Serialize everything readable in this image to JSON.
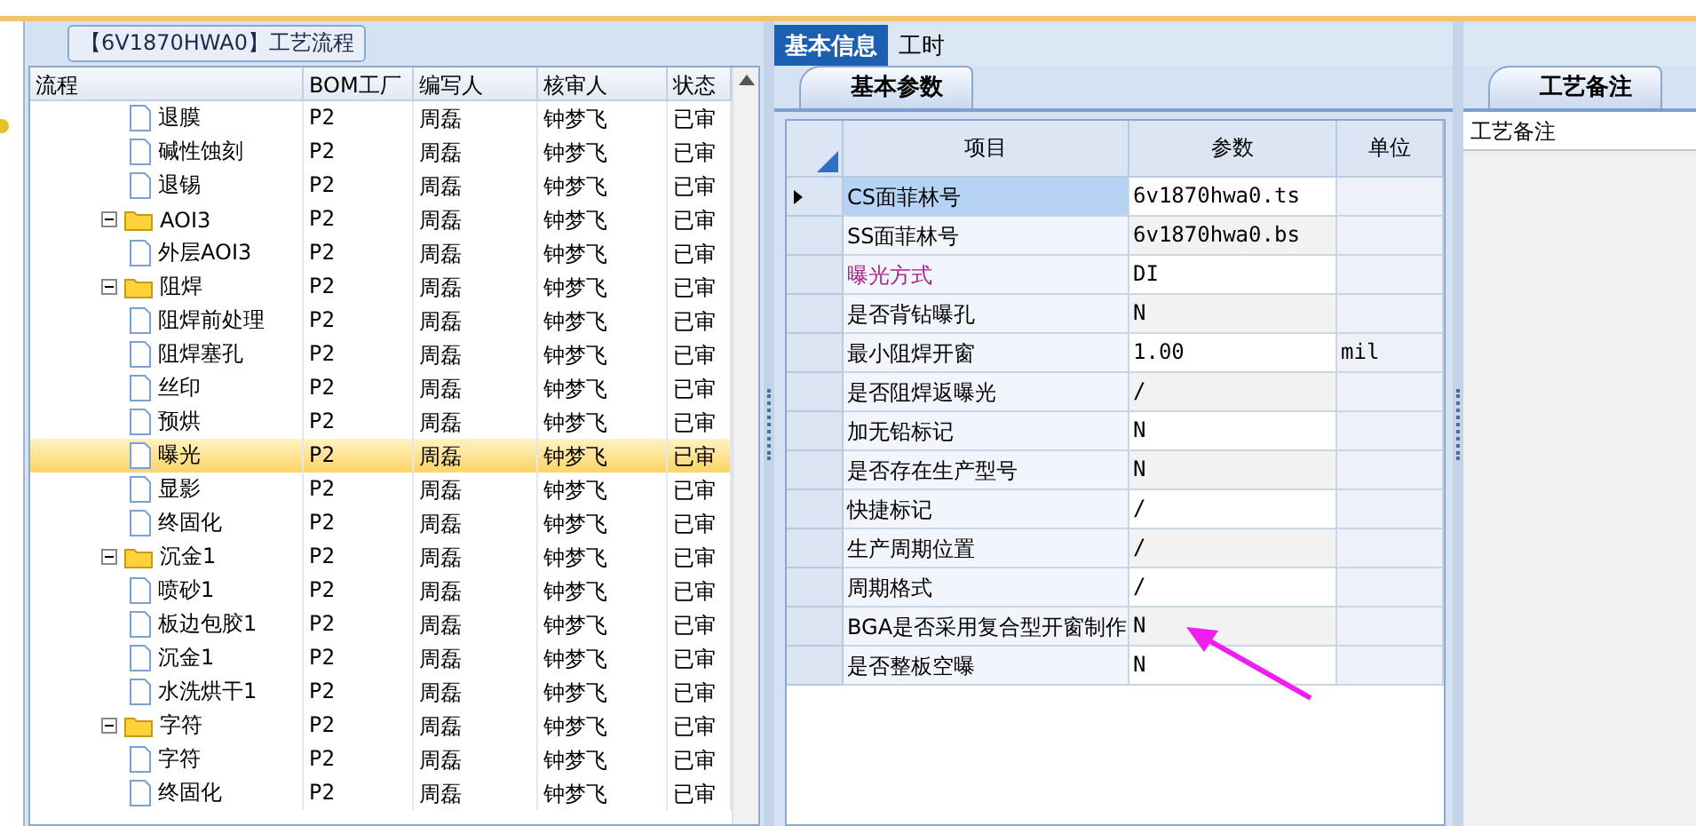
{
  "flow_panel": {
    "title": "【6V1870HWA0】工艺流程",
    "columns": [
      "流程",
      "BOM工厂",
      "编写人",
      "核审人",
      "状态"
    ],
    "rows": [
      {
        "kind": "file",
        "label": "退膜",
        "factory": "P2",
        "writer": "周磊",
        "reviewer": "钟梦飞",
        "status": "已审",
        "selected": false
      },
      {
        "kind": "file",
        "label": "碱性蚀刻",
        "factory": "P2",
        "writer": "周磊",
        "reviewer": "钟梦飞",
        "status": "已审",
        "selected": false
      },
      {
        "kind": "file",
        "label": "退锡",
        "factory": "P2",
        "writer": "周磊",
        "reviewer": "钟梦飞",
        "status": "已审",
        "selected": false
      },
      {
        "kind": "folder",
        "label": "AOI3",
        "factory": "P2",
        "writer": "周磊",
        "reviewer": "钟梦飞",
        "status": "已审",
        "selected": false,
        "expanded": true,
        "children": [
          {
            "kind": "file",
            "label": "外层AOI3",
            "factory": "P2",
            "writer": "周磊",
            "reviewer": "钟梦飞",
            "status": "已审",
            "selected": false
          }
        ]
      },
      {
        "kind": "folder",
        "label": "阻焊",
        "factory": "P2",
        "writer": "周磊",
        "reviewer": "钟梦飞",
        "status": "已审",
        "selected": false,
        "expanded": true,
        "children": [
          {
            "kind": "file",
            "label": "阻焊前处理",
            "factory": "P2",
            "writer": "周磊",
            "reviewer": "钟梦飞",
            "status": "已审",
            "selected": false
          },
          {
            "kind": "file",
            "label": "阻焊塞孔",
            "factory": "P2",
            "writer": "周磊",
            "reviewer": "钟梦飞",
            "status": "已审",
            "selected": false
          },
          {
            "kind": "file",
            "label": "丝印",
            "factory": "P2",
            "writer": "周磊",
            "reviewer": "钟梦飞",
            "status": "已审",
            "selected": false
          },
          {
            "kind": "file",
            "label": "预烘",
            "factory": "P2",
            "writer": "周磊",
            "reviewer": "钟梦飞",
            "status": "已审",
            "selected": false
          },
          {
            "kind": "file",
            "label": "曝光",
            "factory": "P2",
            "writer": "周磊",
            "reviewer": "钟梦飞",
            "status": "已审",
            "selected": true
          },
          {
            "kind": "file",
            "label": "显影",
            "factory": "P2",
            "writer": "周磊",
            "reviewer": "钟梦飞",
            "status": "已审",
            "selected": false
          },
          {
            "kind": "file",
            "label": "终固化",
            "factory": "P2",
            "writer": "周磊",
            "reviewer": "钟梦飞",
            "status": "已审",
            "selected": false
          }
        ]
      },
      {
        "kind": "folder",
        "label": "沉金1",
        "factory": "P2",
        "writer": "周磊",
        "reviewer": "钟梦飞",
        "status": "已审",
        "selected": false,
        "expanded": true,
        "children": [
          {
            "kind": "file",
            "label": "喷砂1",
            "factory": "P2",
            "writer": "周磊",
            "reviewer": "钟梦飞",
            "status": "已审",
            "selected": false
          },
          {
            "kind": "file",
            "label": "板边包胶1",
            "factory": "P2",
            "writer": "周磊",
            "reviewer": "钟梦飞",
            "status": "已审",
            "selected": false
          },
          {
            "kind": "file",
            "label": "沉金1",
            "factory": "P2",
            "writer": "周磊",
            "reviewer": "钟梦飞",
            "status": "已审",
            "selected": false
          },
          {
            "kind": "file",
            "label": "水洗烘干1",
            "factory": "P2",
            "writer": "周磊",
            "reviewer": "钟梦飞",
            "status": "已审",
            "selected": false
          }
        ]
      },
      {
        "kind": "folder",
        "label": "字符",
        "factory": "P2",
        "writer": "周磊",
        "reviewer": "钟梦飞",
        "status": "已审",
        "selected": false,
        "expanded": true,
        "children": [
          {
            "kind": "file",
            "label": "字符",
            "factory": "P2",
            "writer": "周磊",
            "reviewer": "钟梦飞",
            "status": "已审",
            "selected": false
          },
          {
            "kind": "file",
            "label": "终固化",
            "factory": "P2",
            "writer": "周磊",
            "reviewer": "钟梦飞",
            "status": "已审",
            "selected": false
          }
        ]
      }
    ]
  },
  "tabs": [
    {
      "label": "基本信息",
      "selected": true
    },
    {
      "label": "工时",
      "selected": false
    }
  ],
  "params": {
    "tab": "基本参数",
    "columns": [
      "项目",
      "参数",
      "单位"
    ],
    "rows": [
      {
        "item": "CS面菲林号",
        "value": "6v1870hwa0.ts",
        "unit": "",
        "current": true,
        "color": "#000000"
      },
      {
        "item": "SS面菲林号",
        "value": "6v1870hwa0.bs",
        "unit": "",
        "current": false,
        "color": "#000000"
      },
      {
        "item": "曝光方式",
        "value": "DI",
        "unit": "",
        "current": false,
        "color": "#b0208c"
      },
      {
        "item": "是否背钻曝孔",
        "value": "N",
        "unit": "",
        "current": false,
        "color": "#000000"
      },
      {
        "item": "最小阻焊开窗",
        "value": "1.00",
        "unit": "mil",
        "current": false,
        "color": "#000000"
      },
      {
        "item": "是否阻焊返曝光",
        "value": "/",
        "unit": "",
        "current": false,
        "color": "#000000"
      },
      {
        "item": "加无铅标记",
        "value": "N",
        "unit": "",
        "current": false,
        "color": "#000000"
      },
      {
        "item": "是否存在生产型号",
        "value": "N",
        "unit": "",
        "current": false,
        "color": "#000000"
      },
      {
        "item": "快捷标记",
        "value": "/",
        "unit": "",
        "current": false,
        "color": "#000000"
      },
      {
        "item": "生产周期位置",
        "value": "/",
        "unit": "",
        "current": false,
        "color": "#000000"
      },
      {
        "item": "周期格式",
        "value": "/",
        "unit": "",
        "current": false,
        "color": "#000000"
      },
      {
        "item": "BGA是否采用复合型开窗制作",
        "value": "N",
        "unit": "",
        "current": false,
        "color": "#000000"
      },
      {
        "item": "是否整板空曝",
        "value": "N",
        "unit": "",
        "current": false,
        "color": "#000000"
      }
    ]
  },
  "notes": {
    "tab": "工艺备注",
    "header": "工艺备注"
  }
}
